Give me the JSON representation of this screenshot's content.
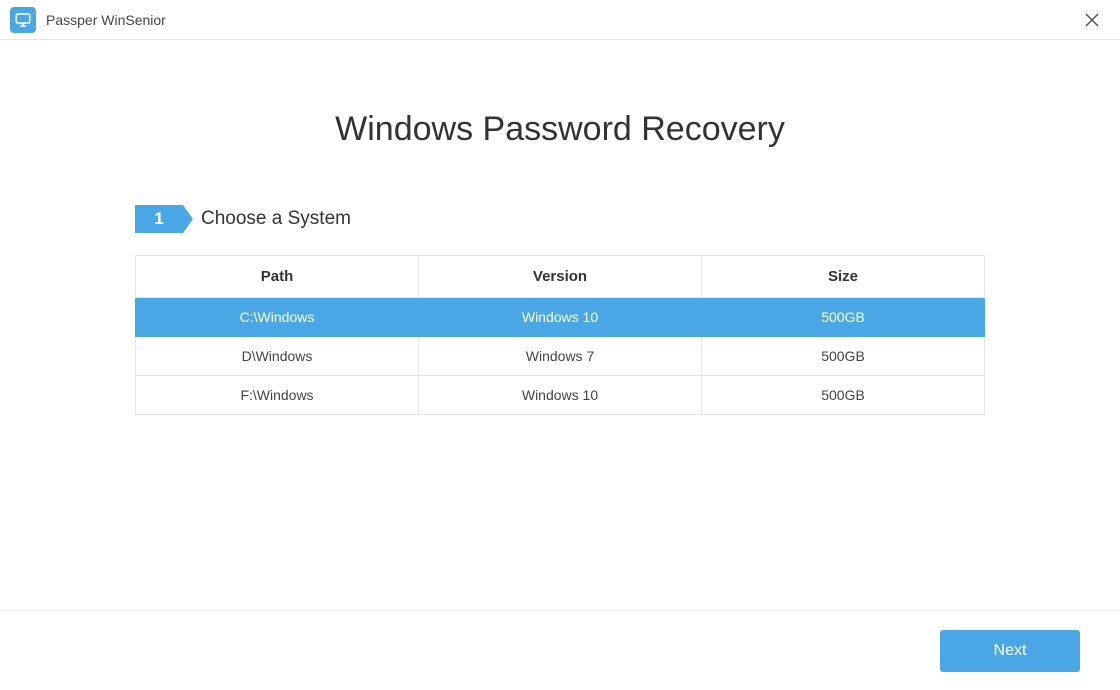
{
  "titlebar": {
    "app_name": "Passper WinSenior"
  },
  "main": {
    "title": "Windows Password Recovery",
    "step": {
      "number": "1",
      "label": "Choose a System"
    },
    "table": {
      "headers": {
        "path": "Path",
        "version": "Version",
        "size": "Size"
      },
      "rows": [
        {
          "path": "C:\\Windows",
          "version": "Windows 10",
          "size": "500GB",
          "selected": true
        },
        {
          "path": "D\\Windows",
          "version": "Windows 7",
          "size": "500GB",
          "selected": false
        },
        {
          "path": "F:\\Windows",
          "version": "Windows 10",
          "size": "500GB",
          "selected": false
        }
      ]
    }
  },
  "footer": {
    "next_label": "Next"
  }
}
